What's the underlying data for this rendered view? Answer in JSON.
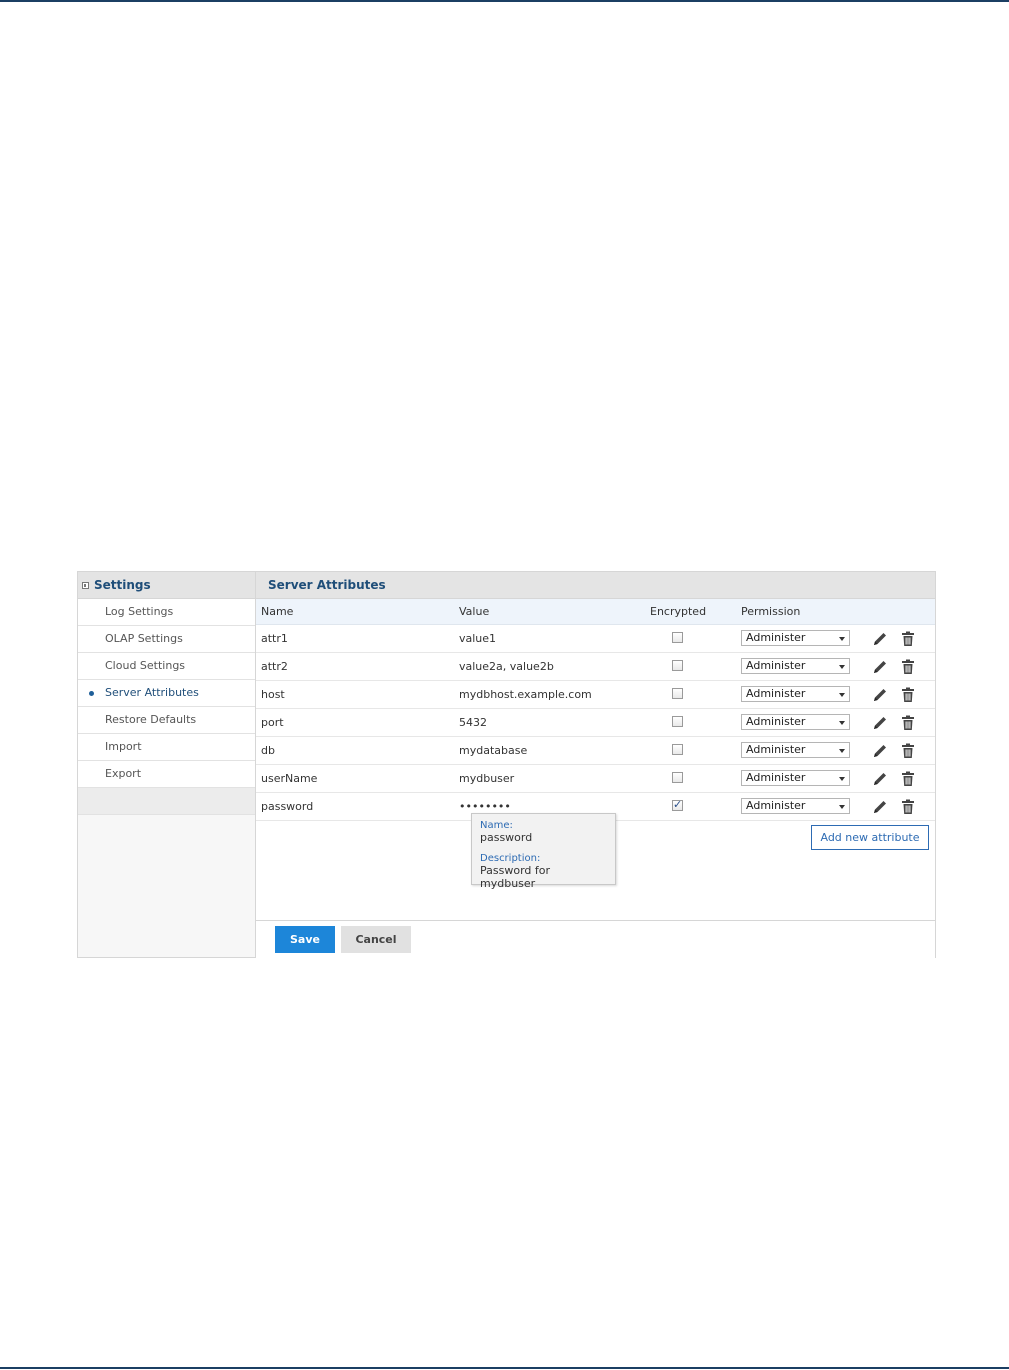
{
  "sidebar": {
    "title": "Settings",
    "items": [
      {
        "label": "Log Settings",
        "active": false
      },
      {
        "label": "OLAP Settings",
        "active": false
      },
      {
        "label": "Cloud Settings",
        "active": false
      },
      {
        "label": "Server Attributes",
        "active": true
      },
      {
        "label": "Restore Defaults",
        "active": false
      },
      {
        "label": "Import",
        "active": false
      },
      {
        "label": "Export",
        "active": false
      }
    ]
  },
  "main": {
    "title": "Server Attributes",
    "columns": {
      "name": "Name",
      "value": "Value",
      "encrypted": "Encrypted",
      "permission": "Permission"
    },
    "rows": [
      {
        "name": "attr1",
        "value": "value1",
        "encrypted": false,
        "permission": "Administer"
      },
      {
        "name": "attr2",
        "value": "value2a, value2b",
        "encrypted": false,
        "permission": "Administer"
      },
      {
        "name": "host",
        "value": "mydbhost.example.com",
        "encrypted": false,
        "permission": "Administer"
      },
      {
        "name": "port",
        "value": "5432",
        "encrypted": false,
        "permission": "Administer"
      },
      {
        "name": "db",
        "value": "mydatabase",
        "encrypted": false,
        "permission": "Administer"
      },
      {
        "name": "userName",
        "value": "mydbuser",
        "encrypted": false,
        "permission": "Administer"
      },
      {
        "name": "password",
        "value": "••••••••",
        "encrypted": true,
        "permission": "Administer"
      }
    ],
    "tooltip": {
      "name_label": "Name:",
      "name_value": "password",
      "description_label": "Description:",
      "description_value": "Password for mydbuser"
    },
    "add_button": "Add new attribute",
    "save_button": "Save",
    "cancel_button": "Cancel"
  },
  "icons": {
    "edit": "pencil-icon",
    "delete": "trash-icon",
    "collapse": "collapse-icon",
    "dropdown": "chevron-down-icon"
  },
  "colors": {
    "accent": "#1d86d9",
    "heading": "#1f4e79",
    "rule": "#1b3f63"
  }
}
